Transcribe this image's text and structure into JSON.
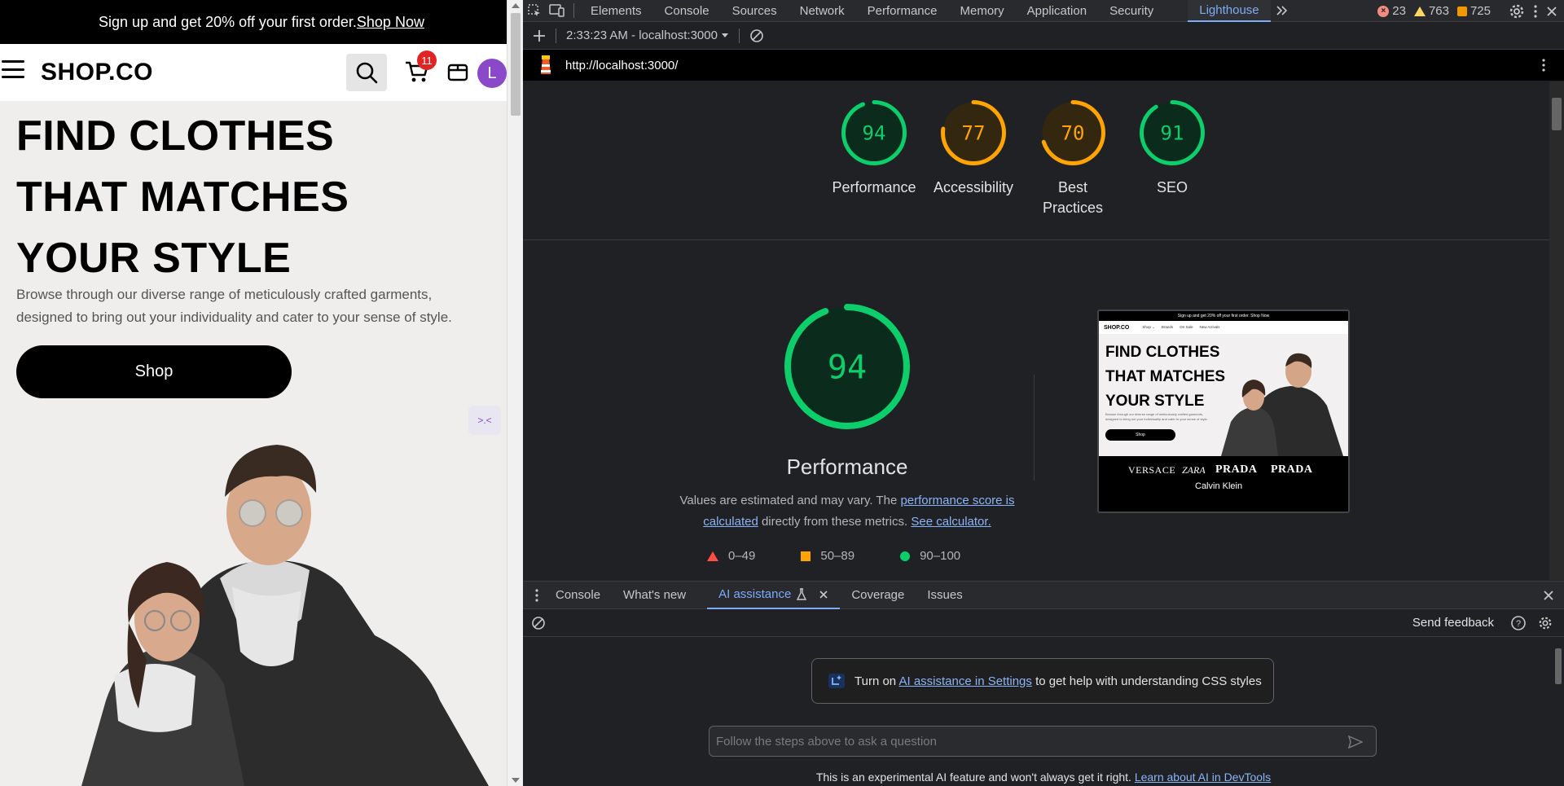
{
  "site": {
    "promo_text": "Sign up and get 20% off your first order.",
    "promo_link": "Shop Now",
    "logo": "SHOP.CO",
    "cart_count": "11",
    "avatar_initial": "L",
    "hero_lines": [
      "FIND CLOTHES",
      "THAT MATCHES",
      "YOUR STYLE"
    ],
    "hero_desc": "Browse through our diverse range of meticulously crafted garments, designed to bring out your individuality and cater to your sense of style.",
    "shop_button": "Shop",
    "widget_glyph": ">.<"
  },
  "devtools": {
    "tabs": [
      "Elements",
      "Console",
      "Sources",
      "Network",
      "Performance",
      "Memory",
      "Application",
      "Security",
      "Lighthouse"
    ],
    "active_tab": "Lighthouse",
    "errors": "23",
    "warnings": "763",
    "issues": "725",
    "report_selector": "2:33:23 AM - localhost:3000",
    "url": "http://localhost:3000/",
    "scores": [
      {
        "label": "Performance",
        "value": 94,
        "status": "pass"
      },
      {
        "label": "Accessibility",
        "value": 77,
        "status": "average"
      },
      {
        "label": "Best Practices",
        "value": 70,
        "status": "average"
      },
      {
        "label": "SEO",
        "value": 91,
        "status": "pass"
      }
    ],
    "main_score": {
      "label": "Performance",
      "value": 94
    },
    "note_prefix": "Values are estimated and may vary. The ",
    "note_link1": "performance score is calculated",
    "note_middle": " directly from these metrics. ",
    "note_link2": "See calculator.",
    "legend": [
      "0–49",
      "50–89",
      "90–100"
    ],
    "colors": {
      "pass": "#0cce6b",
      "average": "#ffa400",
      "fail": "#ff4e42",
      "accent": "#7cacf8"
    },
    "screenshot": {
      "promo": "Sign up and get 20% off your first order. Shop Now",
      "logo": "SHOP.CO",
      "nav": [
        "Shop ⌄",
        "Brands",
        "On Sale",
        "New Arrivals"
      ],
      "title_lines": [
        "FIND CLOTHES",
        "THAT MATCHES",
        "YOUR STYLE"
      ],
      "desc": "Browse through our diverse range of meticulously crafted garments, designed to bring out your individuality and cater to your sense of style.",
      "button": "Shop",
      "brands": [
        "VERSACE",
        "ZARA",
        "PRADA",
        "PRADA",
        "Calvin Klein"
      ]
    }
  },
  "drawer": {
    "tabs": [
      "Console",
      "What's new",
      "AI assistance",
      "Coverage",
      "Issues"
    ],
    "active_tab": "AI assistance",
    "send_feedback": "Send feedback",
    "banner_prefix": "Turn on ",
    "banner_link": "AI assistance in Settings",
    "banner_suffix": " to get help with understanding CSS styles",
    "input_placeholder": "Follow the steps above to ask a question",
    "footer_text": "This is an experimental AI feature and won't always get it right. ",
    "footer_link": "Learn about AI in DevTools"
  }
}
